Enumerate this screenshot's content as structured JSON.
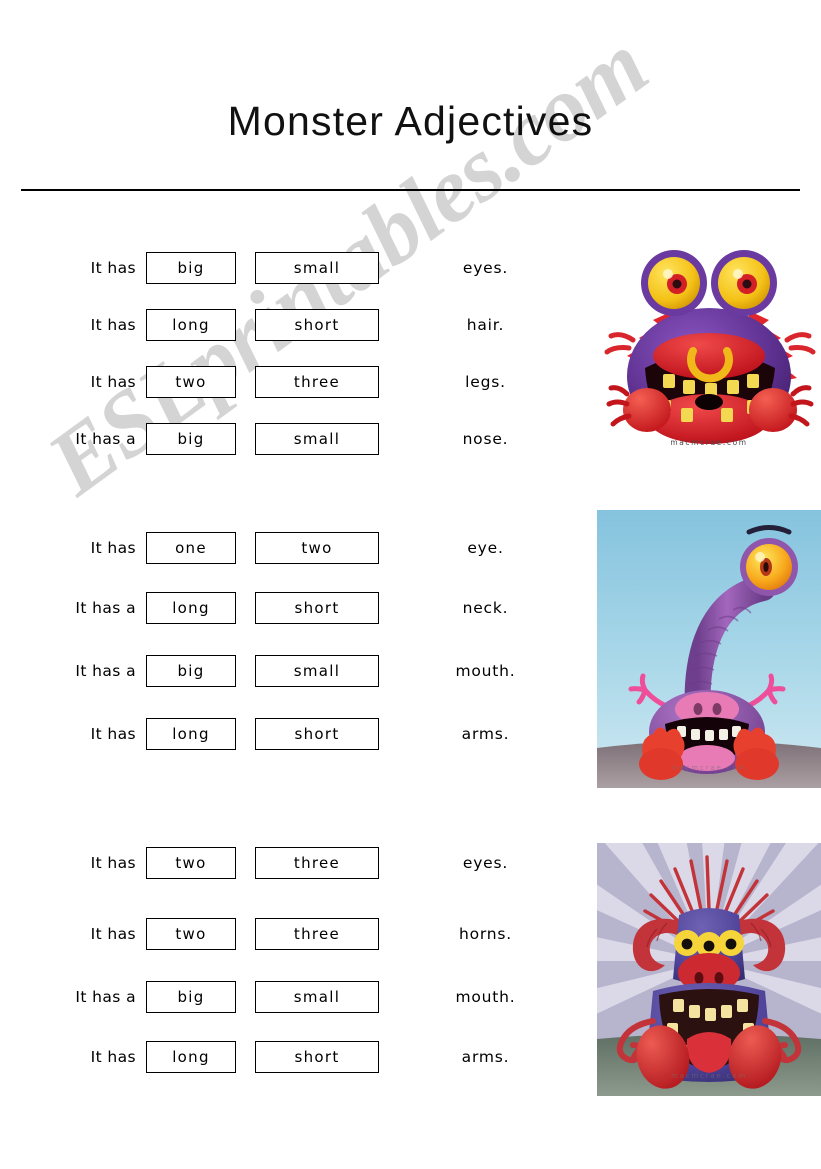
{
  "document": {
    "title": "Monster Adjectives",
    "watermark": "ESLprintables.com"
  },
  "groups": [
    {
      "id": "group-1",
      "rows": [
        {
          "subject": "It has",
          "choice_a": "big",
          "choice_b": "small",
          "noun": "eyes."
        },
        {
          "subject": "It has",
          "choice_a": "long",
          "choice_b": "short",
          "noun": "hair."
        },
        {
          "subject": "It has",
          "choice_a": "two",
          "choice_b": "three",
          "noun": "legs."
        },
        {
          "subject": "It has a",
          "choice_a": "big",
          "choice_b": "small",
          "noun": "nose."
        }
      ],
      "figure": {
        "name": "monster-one",
        "caption": "macmcrae.com",
        "colors": {
          "body": "#5b2f8f",
          "body_light": "#7a4ab0",
          "eye": "#f6c81f",
          "iris": "#d42024",
          "accent": "#e8232a",
          "teeth": "#f2d23c"
        }
      }
    },
    {
      "id": "group-2",
      "rows": [
        {
          "subject": "It has",
          "choice_a": "one",
          "choice_b": "two",
          "noun": "eye."
        },
        {
          "subject": "It has a",
          "choice_a": "long",
          "choice_b": "short",
          "noun": "neck."
        },
        {
          "subject": "It has a",
          "choice_a": "big",
          "choice_b": "small",
          "noun": "mouth."
        },
        {
          "subject": "It has",
          "choice_a": "long",
          "choice_b": "short",
          "noun": "arms."
        }
      ],
      "figure": {
        "name": "monster-two",
        "caption": "macmcrae.com",
        "colors": {
          "sky_top": "#8dc6e0",
          "sky_bottom": "#bfe0ee",
          "ground": "#8e8086",
          "body": "#9b5fb5",
          "body_dark": "#7a4594",
          "eye": "#f6b11c",
          "snout": "#e87bb5",
          "arms": "#ef4e9b",
          "feet": "#e8402f"
        }
      }
    },
    {
      "id": "group-3",
      "rows": [
        {
          "subject": "It has",
          "choice_a": "two",
          "choice_b": "three",
          "noun": "eyes."
        },
        {
          "subject": "It has",
          "choice_a": "two",
          "choice_b": "three",
          "noun": "horns."
        },
        {
          "subject": "It has a",
          "choice_a": "big",
          "choice_b": "small",
          "noun": "mouth."
        },
        {
          "subject": "It has",
          "choice_a": "long",
          "choice_b": "short",
          "noun": "arms."
        }
      ],
      "figure": {
        "name": "monster-three",
        "caption": "macmcrae.com",
        "colors": {
          "bg": "#b9b6cf",
          "rays": "#d8d6e6",
          "floor": "#6c7a6e",
          "body": "#5b4f9e",
          "body_dark": "#443a80",
          "horns": "#c2333a",
          "eye": "#f5d53a",
          "nose": "#cc2a30",
          "tongue": "#d9303a",
          "teeth": "#f4e4a0"
        }
      }
    }
  ]
}
